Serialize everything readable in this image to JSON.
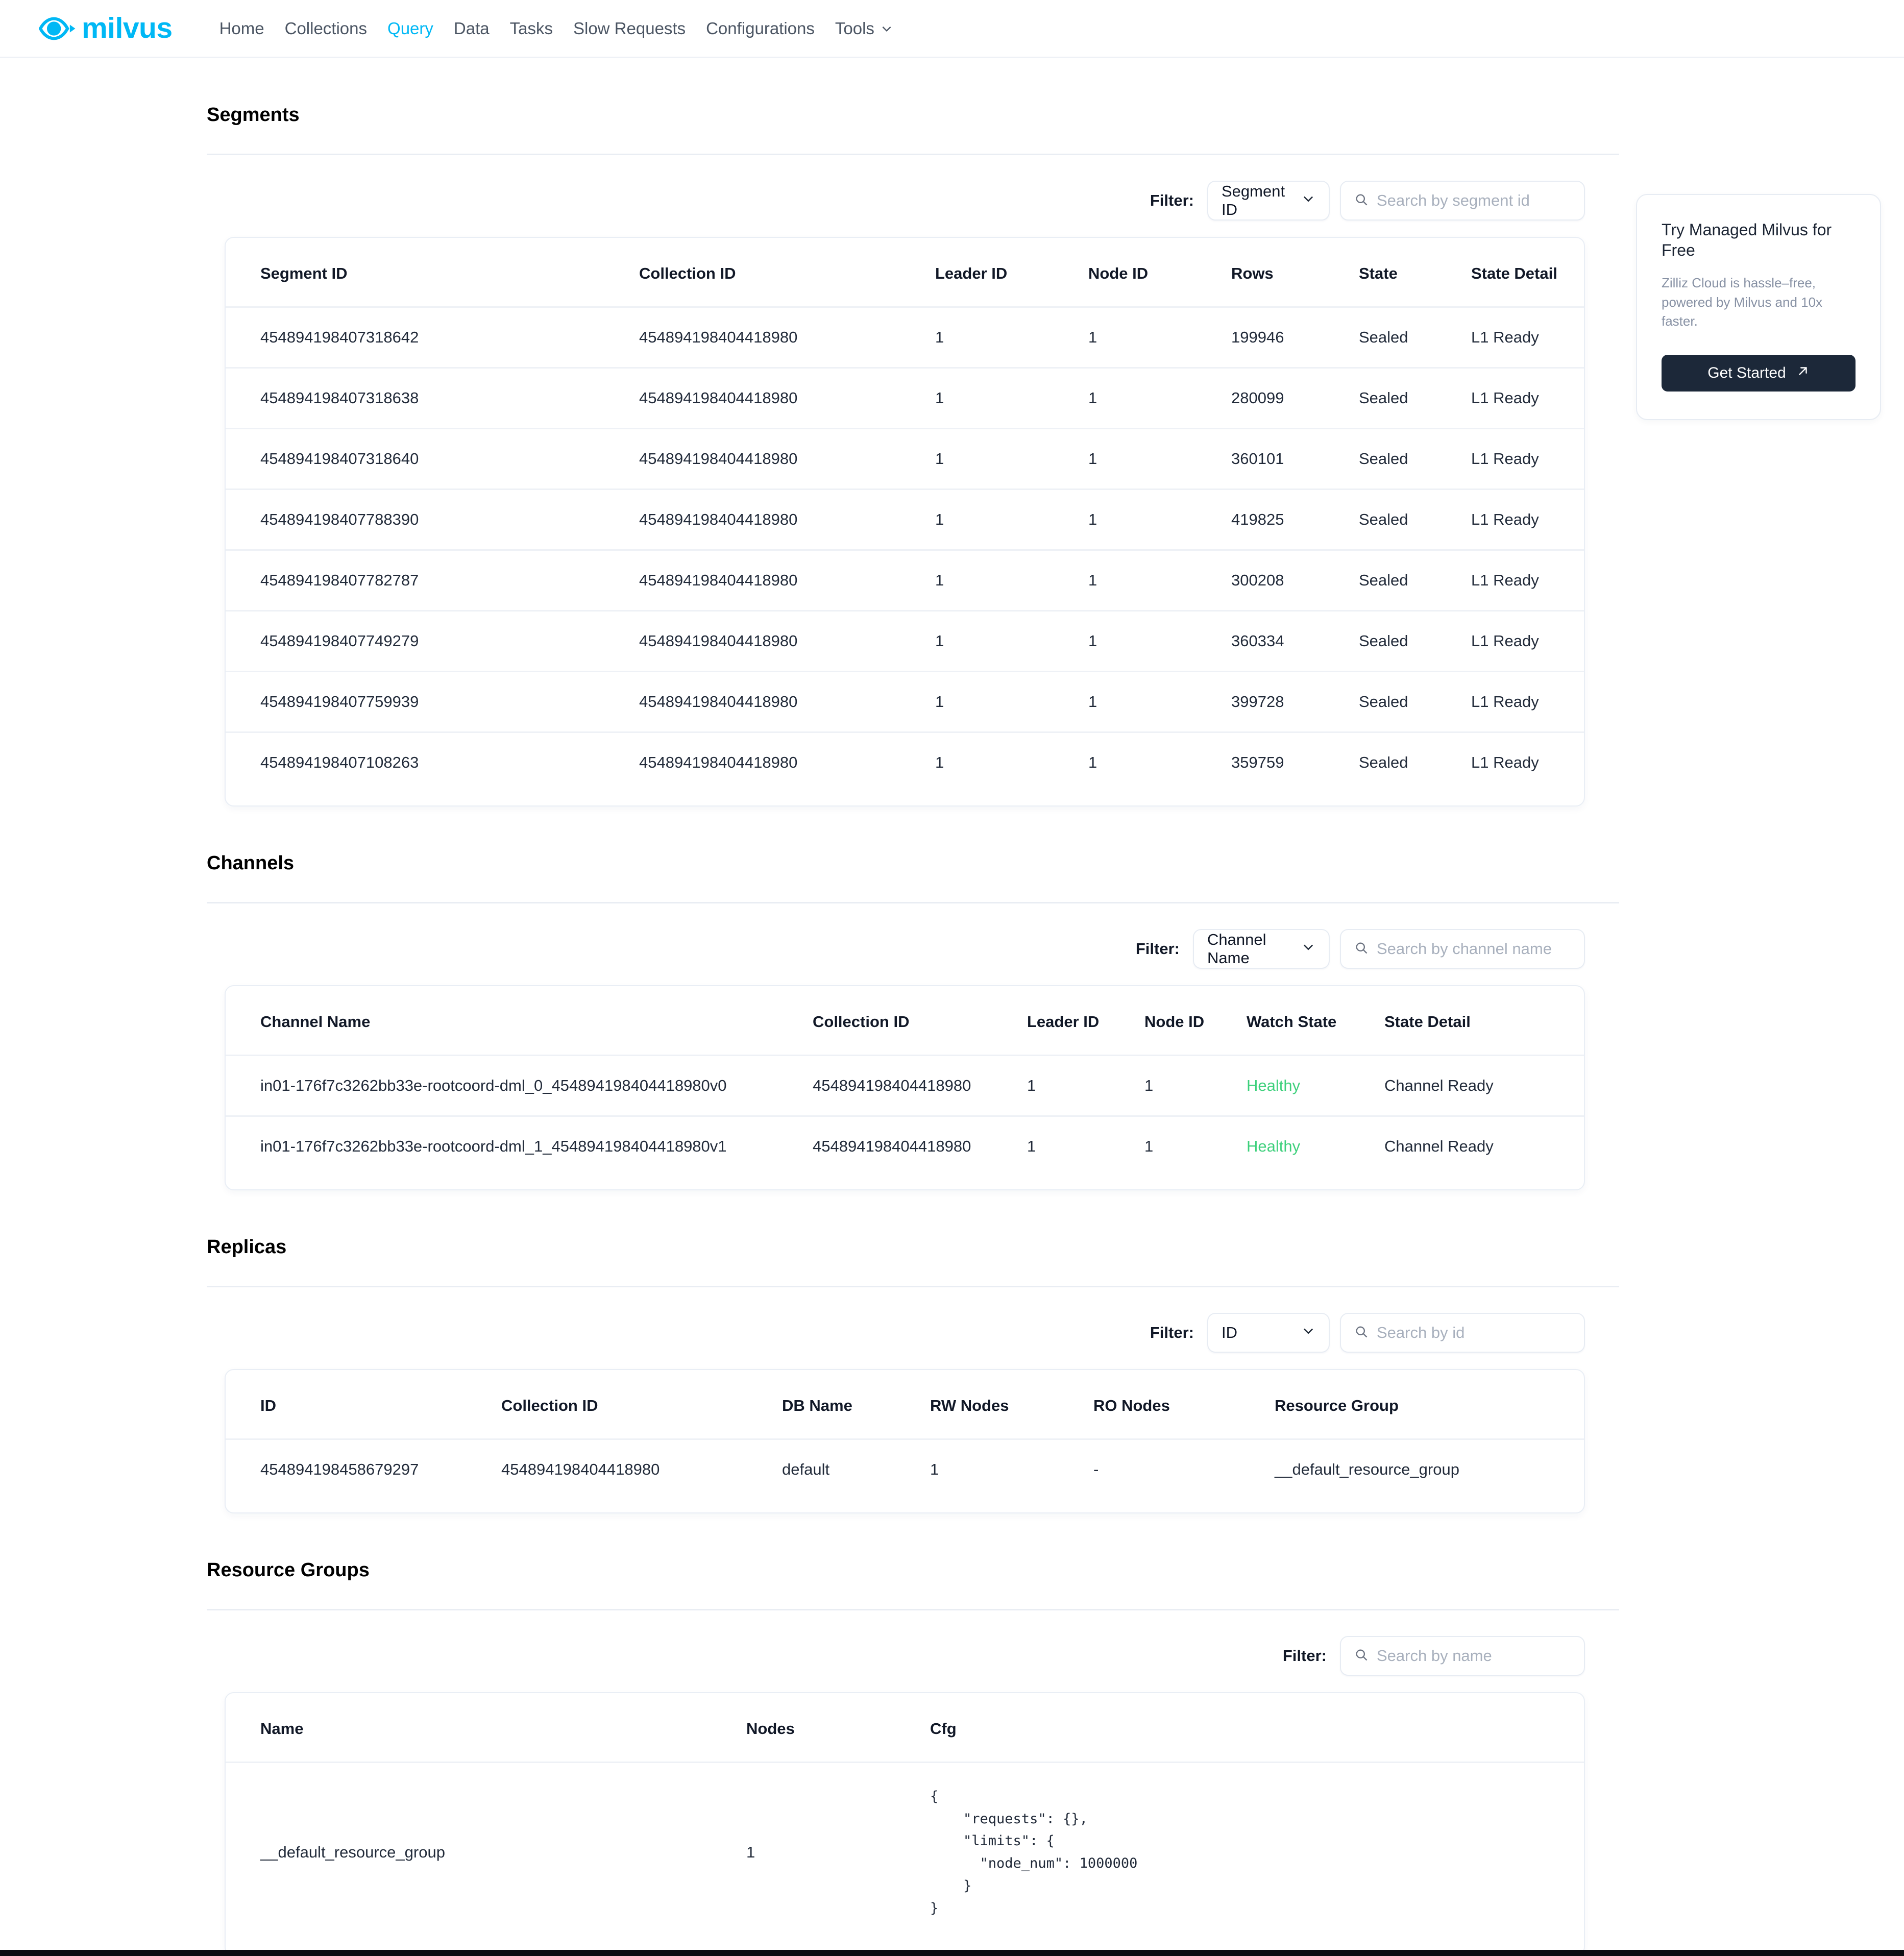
{
  "nav": {
    "brand": "milvus",
    "brand_icon": "milvus-eye-logo",
    "links": [
      {
        "label": "Home",
        "active": false
      },
      {
        "label": "Collections",
        "active": false
      },
      {
        "label": "Query",
        "active": true
      },
      {
        "label": "Data",
        "active": false
      },
      {
        "label": "Tasks",
        "active": false
      },
      {
        "label": "Slow Requests",
        "active": false
      },
      {
        "label": "Configurations",
        "active": false
      },
      {
        "label": "Tools",
        "active": false,
        "caret": true
      }
    ]
  },
  "accent_color": "#00B8F5",
  "healthy_color": "#3ed07c",
  "filter_label": "Filter:",
  "segments": {
    "title": "Segments",
    "filter": {
      "label": "Filter:",
      "select_value": "Segment ID",
      "search_placeholder": "Search by segment id",
      "search_value": ""
    },
    "columns": [
      "Segment ID",
      "Collection ID",
      "Leader ID",
      "Node ID",
      "Rows",
      "State",
      "State Detail"
    ],
    "rows": [
      {
        "segment_id": "454894198407318642",
        "collection_id": "454894198404418980",
        "leader_id": "1",
        "node_id": "1",
        "rows": "199946",
        "state": "Sealed",
        "state_detail": "L1 Ready"
      },
      {
        "segment_id": "454894198407318638",
        "collection_id": "454894198404418980",
        "leader_id": "1",
        "node_id": "1",
        "rows": "280099",
        "state": "Sealed",
        "state_detail": "L1 Ready"
      },
      {
        "segment_id": "454894198407318640",
        "collection_id": "454894198404418980",
        "leader_id": "1",
        "node_id": "1",
        "rows": "360101",
        "state": "Sealed",
        "state_detail": "L1 Ready"
      },
      {
        "segment_id": "454894198407788390",
        "collection_id": "454894198404418980",
        "leader_id": "1",
        "node_id": "1",
        "rows": "419825",
        "state": "Sealed",
        "state_detail": "L1 Ready"
      },
      {
        "segment_id": "454894198407782787",
        "collection_id": "454894198404418980",
        "leader_id": "1",
        "node_id": "1",
        "rows": "300208",
        "state": "Sealed",
        "state_detail": "L1 Ready"
      },
      {
        "segment_id": "454894198407749279",
        "collection_id": "454894198404418980",
        "leader_id": "1",
        "node_id": "1",
        "rows": "360334",
        "state": "Sealed",
        "state_detail": "L1 Ready"
      },
      {
        "segment_id": "454894198407759939",
        "collection_id": "454894198404418980",
        "leader_id": "1",
        "node_id": "1",
        "rows": "399728",
        "state": "Sealed",
        "state_detail": "L1 Ready"
      },
      {
        "segment_id": "454894198407108263",
        "collection_id": "454894198404418980",
        "leader_id": "1",
        "node_id": "1",
        "rows": "359759",
        "state": "Sealed",
        "state_detail": "L1 Ready"
      }
    ]
  },
  "channels": {
    "title": "Channels",
    "filter": {
      "label": "Filter:",
      "select_value": "Channel Name",
      "search_placeholder": "Search by channel name",
      "search_value": ""
    },
    "columns": [
      "Channel Name",
      "Collection ID",
      "Leader ID",
      "Node ID",
      "Watch State",
      "State Detail"
    ],
    "rows": [
      {
        "channel_name": "in01-176f7c3262bb33e-rootcoord-dml_0_454894198404418980v0",
        "collection_id": "454894198404418980",
        "leader_id": "1",
        "node_id": "1",
        "watch_state": "Healthy",
        "state_detail": "Channel Ready"
      },
      {
        "channel_name": "in01-176f7c3262bb33e-rootcoord-dml_1_454894198404418980v1",
        "collection_id": "454894198404418980",
        "leader_id": "1",
        "node_id": "1",
        "watch_state": "Healthy",
        "state_detail": "Channel Ready"
      }
    ]
  },
  "replicas": {
    "title": "Replicas",
    "filter": {
      "label": "Filter:",
      "select_value": "ID",
      "search_placeholder": "Search by id",
      "search_value": ""
    },
    "columns": [
      "ID",
      "Collection ID",
      "DB Name",
      "RW Nodes",
      "RO Nodes",
      "Resource Group"
    ],
    "rows": [
      {
        "id": "454894198458679297",
        "collection_id": "454894198404418980",
        "db_name": "default",
        "rw_nodes": "1",
        "ro_nodes": "-",
        "resource_group": "__default_resource_group"
      }
    ]
  },
  "resource_groups": {
    "title": "Resource Groups",
    "filter": {
      "label": "Filter:",
      "search_placeholder": "Search by name",
      "search_value": ""
    },
    "columns": [
      "Name",
      "Nodes",
      "Cfg"
    ],
    "rows": [
      {
        "name": "__default_resource_group",
        "nodes": "1",
        "cfg": "{\n    \"requests\": {},\n    \"limits\": {\n      \"node_num\": 1000000\n    }\n}"
      }
    ]
  },
  "promo": {
    "title": "Try Managed Milvus for Free",
    "subtitle": "Zilliz Cloud is hassle–free,\npowered by Milvus and 10x faster.",
    "button_label": "Get Started",
    "button_icon": "external-link-arrow-icon"
  }
}
